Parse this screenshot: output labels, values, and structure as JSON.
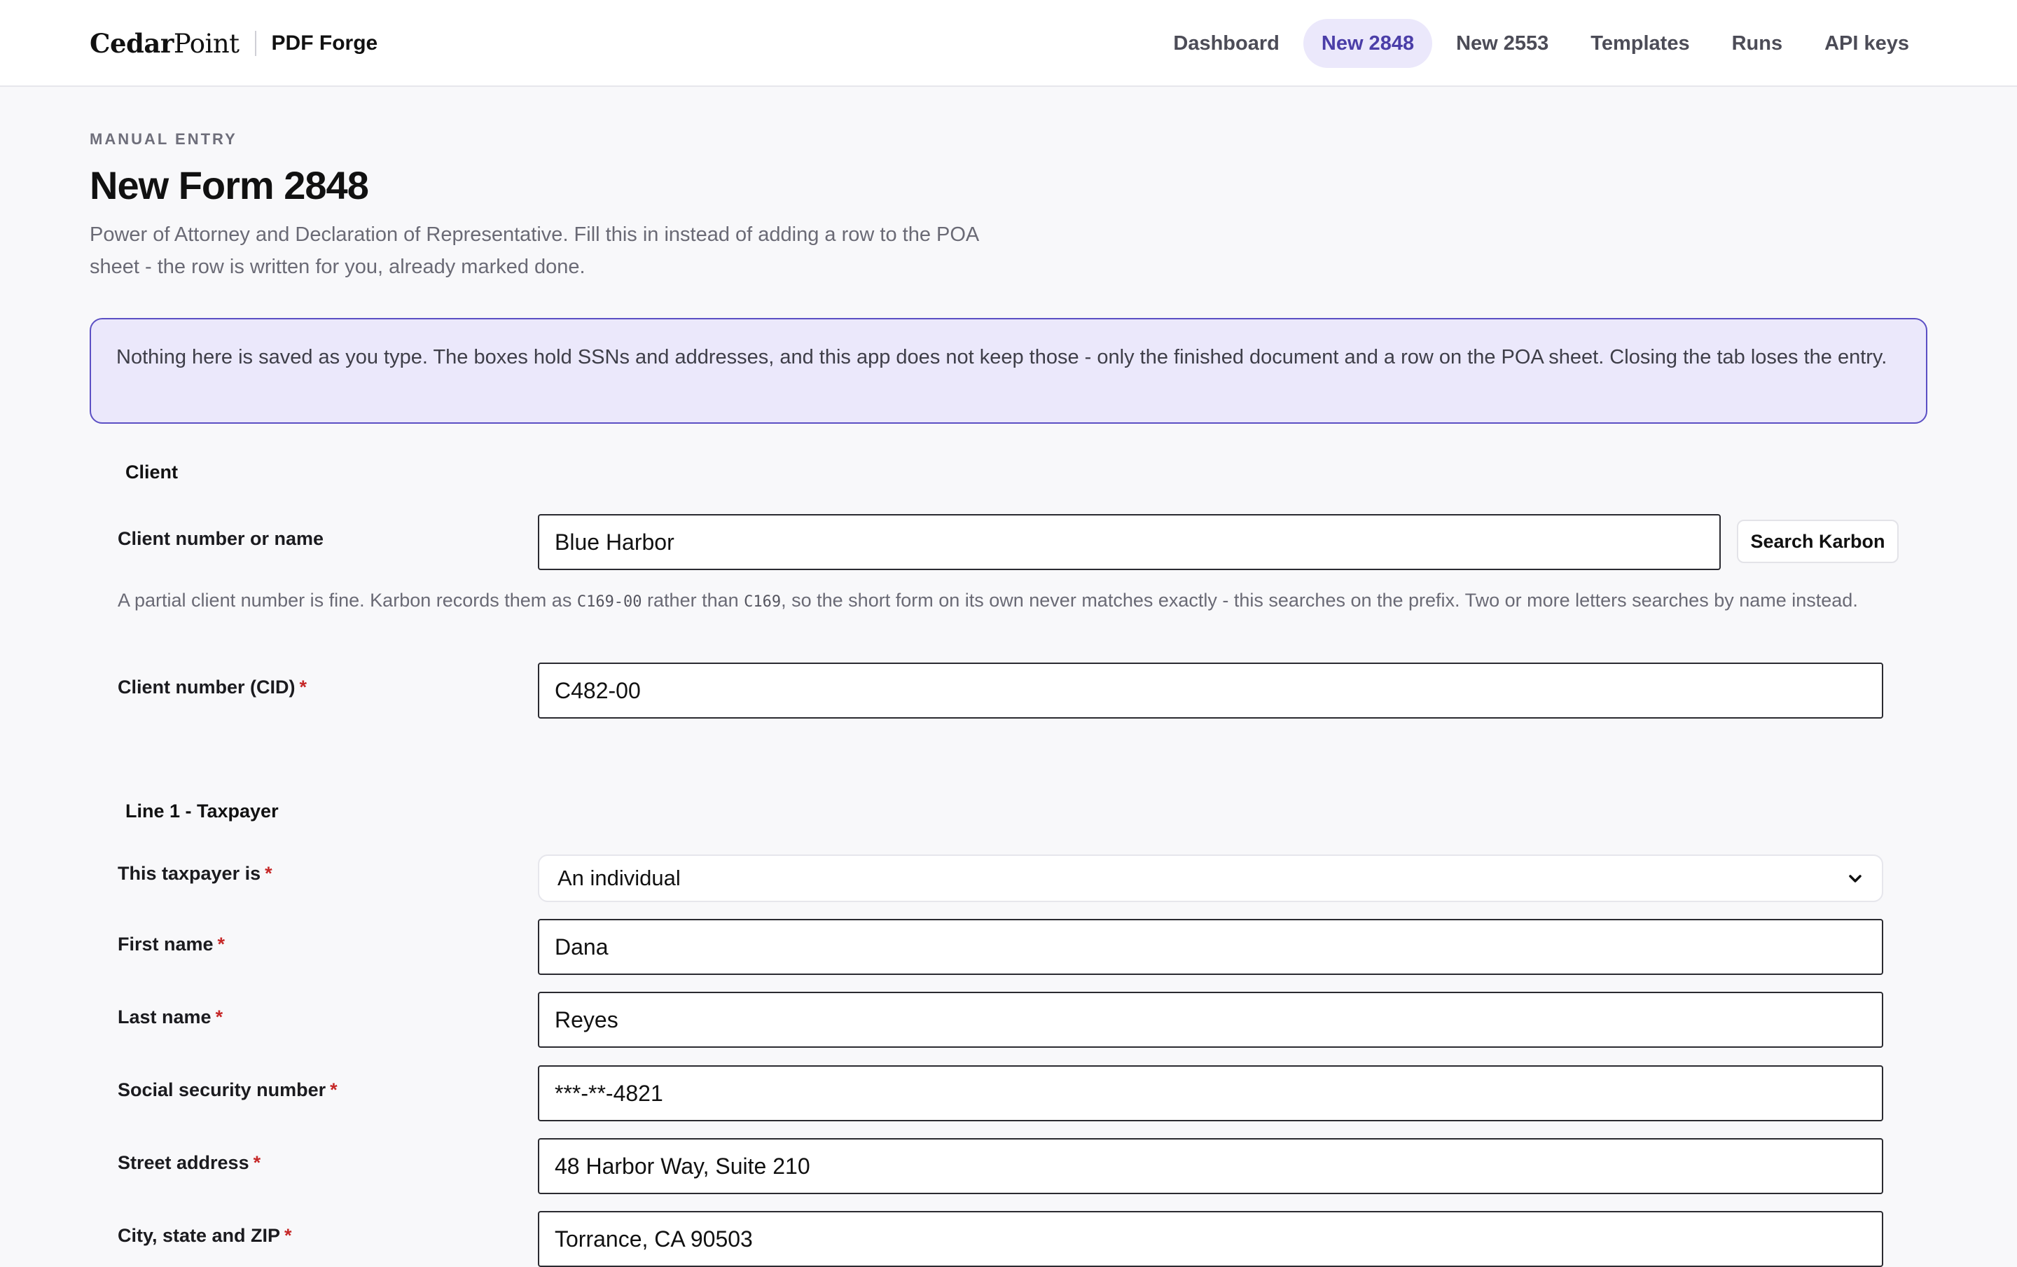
{
  "brand": {
    "logo_bold": "Cedar",
    "logo_rest": "Point",
    "app_name": "PDF Forge"
  },
  "nav": {
    "items": [
      {
        "label": "Dashboard"
      },
      {
        "label": "New 2848",
        "active": true
      },
      {
        "label": "New 2553"
      },
      {
        "label": "Templates"
      },
      {
        "label": "Runs"
      },
      {
        "label": "API keys"
      }
    ]
  },
  "header": {
    "eyebrow": "MANUAL ENTRY",
    "title": "New Form 2848",
    "subtitle": "Power of Attorney and Declaration of Representative. Fill this in instead of adding a row to the POA sheet - the row is written for you, already marked done."
  },
  "notice": {
    "text": "Nothing here is saved as you type. The boxes hold SSNs and addresses, and this app does not keep those - only the finished document and a row on the POA sheet. Closing the tab loses the entry."
  },
  "client": {
    "section_title": "Client",
    "search_label": "Client number or name",
    "search_value": "Blue Harbor",
    "search_button": "Search Karbon",
    "hint": {
      "part1": "A partial client number is fine. Karbon records them as ",
      "code1": "C169-00",
      "part2": " rather than ",
      "code2": "C169",
      "part3": ", so the short form on its own never matches exactly - this searches on the prefix. Two or more letters searches by name instead."
    },
    "cid_label": "Client number (CID)",
    "cid_value": "C482-00",
    "required_mark": "*"
  },
  "taxpayer": {
    "section_title": "Line 1 - Taxpayer",
    "type_label": "This taxpayer is",
    "type_value": "An individual",
    "first_name_label": "First name",
    "first_name_value": "Dana",
    "last_name_label": "Last name",
    "last_name_value": "Reyes",
    "ssn_label": "Social security number",
    "ssn_value": "***-**-4821",
    "street_label": "Street address",
    "street_value": "48 Harbor Way, Suite 210",
    "city_label": "City, state and ZIP",
    "city_value": "Torrance, CA 90503"
  },
  "colors": {
    "accent": "#5b4fc4",
    "accent_bg": "#ebe8fb",
    "nav_active_text": "#4b3ea8",
    "required": "#c62828",
    "page_bg": "#f8f8fa"
  }
}
